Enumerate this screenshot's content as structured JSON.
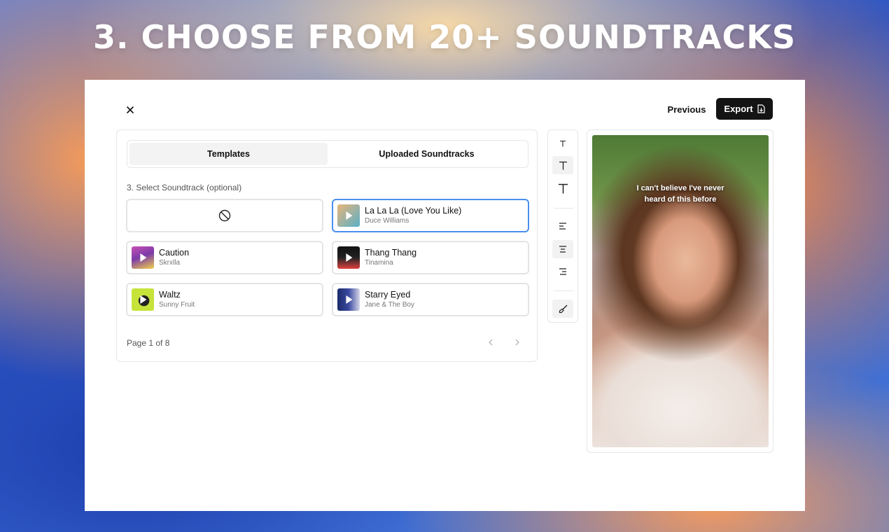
{
  "headline": "3. CHOOSE FROM 20+ SOUNDTRACKS",
  "header": {
    "previous_label": "Previous",
    "export_label": "Export"
  },
  "tabs": [
    {
      "label": "Templates",
      "active": true
    },
    {
      "label": "Uploaded Soundtracks",
      "active": false
    }
  ],
  "section_label": "3. Select Soundtrack (optional)",
  "tracks": [
    {
      "title": "La La La (Love You Like)",
      "artist": "Duce Williams",
      "selected": true,
      "thumb_colors": [
        "#e7b47a",
        "#5ab0c8"
      ]
    },
    {
      "title": "Caution",
      "artist": "Skrxlla",
      "selected": false,
      "thumb_colors": [
        "#c94fb5",
        "#f2d14a"
      ]
    },
    {
      "title": "Thang Thang",
      "artist": "Tinamina",
      "selected": false,
      "thumb_colors": [
        "#111111",
        "#e04040"
      ]
    },
    {
      "title": "Waltz",
      "artist": "Sunny Fruit",
      "selected": false,
      "thumb_colors": [
        "#c6e33a",
        "#222222"
      ]
    },
    {
      "title": "Starry Eyed",
      "artist": "Jane & The Boy",
      "selected": false,
      "thumb_colors": [
        "#1b2a6b",
        "#d6d6e8"
      ]
    }
  ],
  "pagination": {
    "label": "Page 1 of 8"
  },
  "preview": {
    "caption_line1": "I can't believe I've never",
    "caption_line2": "heard of this before"
  },
  "colors": {
    "accent_selected": "#4a8ff0",
    "export_bg": "#141414"
  }
}
